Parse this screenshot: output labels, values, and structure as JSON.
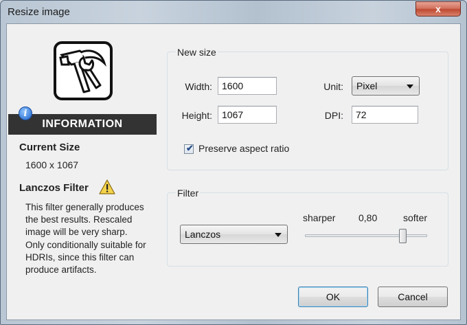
{
  "window": {
    "title": "Resize image",
    "close_label": "x"
  },
  "info": {
    "info_icon_glyph": "i",
    "header": "INFORMATION",
    "current_size_title": "Current Size",
    "current_size_value": "1600 x 1067",
    "filter_title": "Lanczos Filter",
    "filter_description": "This filter generally produces the best results. Rescaled image will be very sharp. Only conditionally suitable for HDRIs, since this filter can produce artifacts."
  },
  "new_size": {
    "group_label": "New size",
    "width_label": "Width:",
    "width_value": "1600",
    "height_label": "Height:",
    "height_value": "1067",
    "unit_label": "Unit:",
    "unit_value": "Pixel",
    "dpi_label": "DPI:",
    "dpi_value": "72",
    "preserve_label": "Preserve aspect ratio",
    "preserve_checked": true
  },
  "filter": {
    "group_label": "Filter",
    "selected": "Lanczos",
    "sharper_label": "sharper",
    "softer_label": "softer",
    "value_text": "0,80",
    "slider_fraction": 0.8
  },
  "buttons": {
    "ok": "OK",
    "cancel": "Cancel"
  },
  "icons": {
    "logo": "hammer-wrench-icon",
    "info": "info-icon",
    "warning": "warning-icon",
    "close": "close-icon"
  }
}
